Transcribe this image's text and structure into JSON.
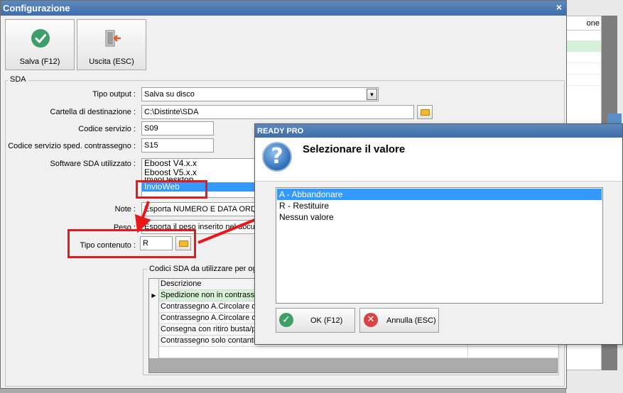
{
  "background_window": {
    "header_fragment": "one"
  },
  "window": {
    "title": "Configurazione",
    "close_glyph": "×"
  },
  "toolbar": {
    "save_label": "Salva (F12)",
    "exit_label": "Uscita (ESC)"
  },
  "sda": {
    "group_title": "SDA",
    "tipo_output_label": "Tipo output :",
    "tipo_output_value": "Salva su disco",
    "cartella_label": "Cartella di destinazione :",
    "cartella_value": "C:\\Distinte\\SDA",
    "codice_servizio_label": "Codice servizio :",
    "codice_servizio_value": "S09",
    "codice_contrassegno_label": "Codice servizio sped. contrassegno :",
    "codice_contrassegno_value": "S15",
    "software_label": "Software SDA utilizzato :",
    "software_options": [
      "Eboost V4.x.x",
      "Eboost V5.x.x",
      "InvioDesktop",
      "InvioWeb"
    ],
    "software_selected": "InvioWeb",
    "note_label": "Note :",
    "note_value": "Esporta NUMERO E DATA ORDINE",
    "peso_label": "Peso :",
    "peso_value": "Esporta il peso inserito nel documento",
    "tipo_contenuto_label": "Tipo contenuto :",
    "tipo_contenuto_value": "R",
    "codici_group_title": "Codici SDA da utilizzare per ogni",
    "grid_header": "Descrizione",
    "grid_rows": [
      "Spedizione non in contrassegno",
      "Contrassegno A.Circolare o",
      "Contrassegno A.Circolare o",
      "Consegna con ritiro busta/p",
      "Contrassegno solo contanti"
    ]
  },
  "dialog": {
    "title": "READY PRO",
    "prompt": "Selezionare il valore",
    "options": [
      "A - Abbandonare",
      "R - Restituire",
      "Nessun valore"
    ],
    "selected_index": 0,
    "ok_label": "OK (F12)",
    "cancel_label": "Annulla (ESC)"
  },
  "colors": {
    "selection": "#3399ff",
    "annotation_red": "#e8181a",
    "titlebar": "#4a78b2",
    "grid_selected_row": "#d6f2d6"
  }
}
